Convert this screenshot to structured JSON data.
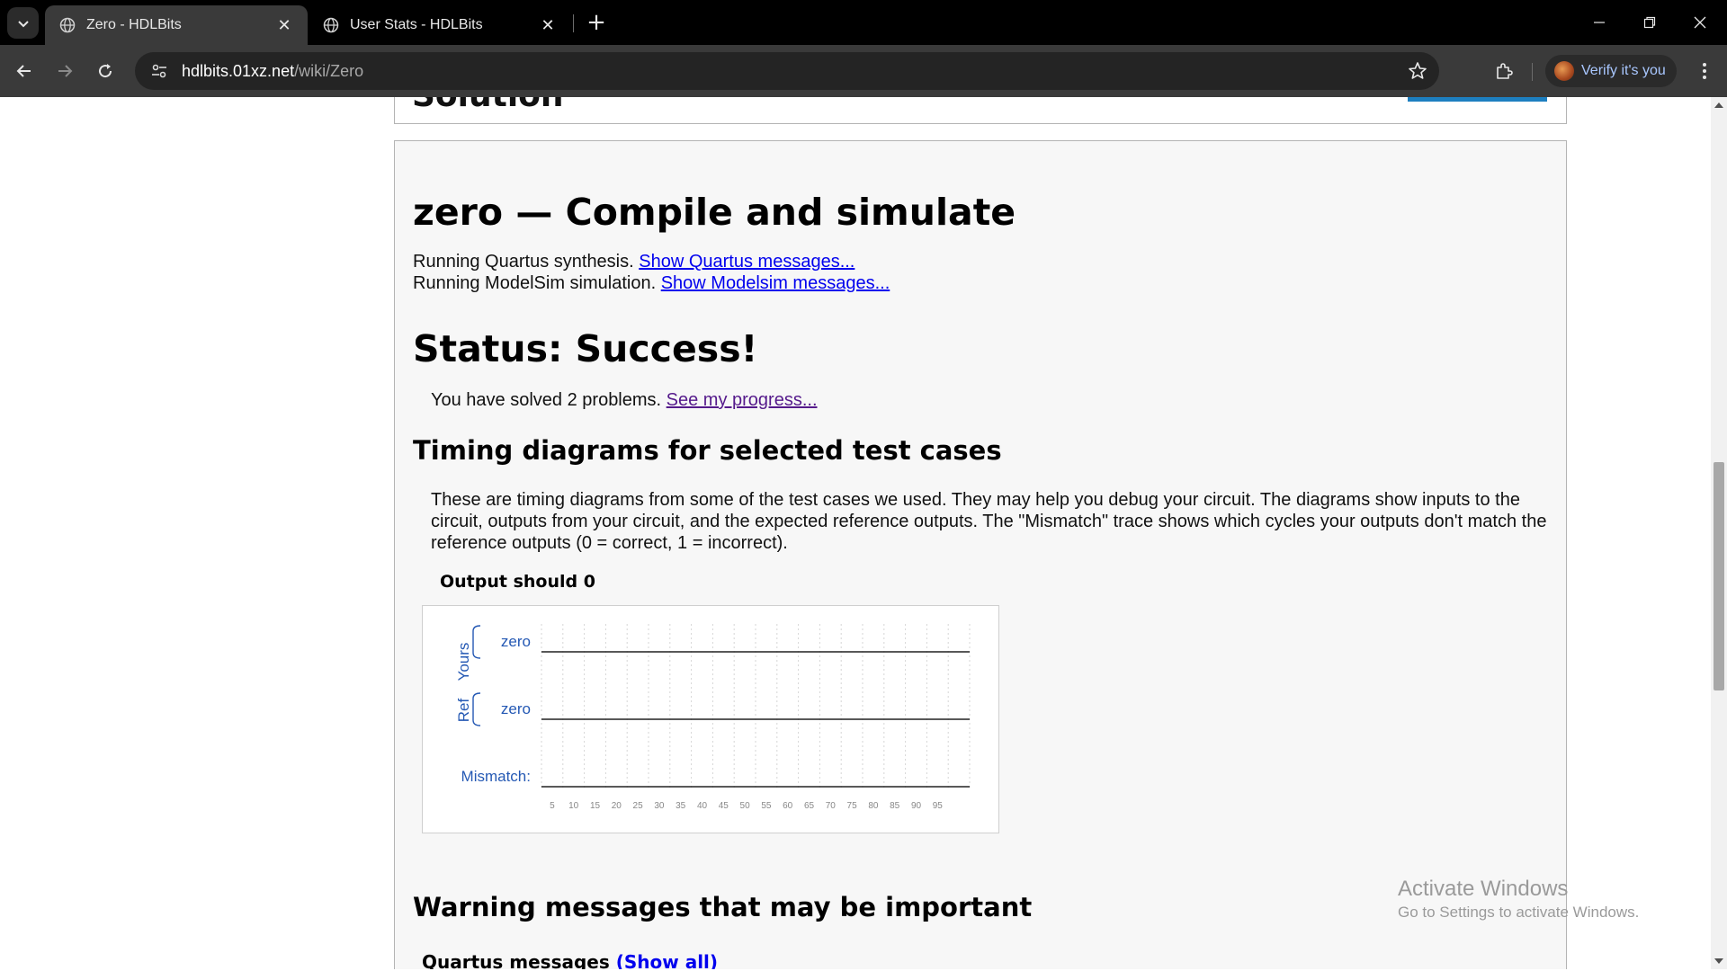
{
  "browser": {
    "tabs": [
      {
        "title": "Zero - HDLBits",
        "active": true
      },
      {
        "title": "User Stats - HDLBits",
        "active": false
      }
    ],
    "url_host": "hdlbits.01xz.net",
    "url_path": "/wiki/Zero",
    "verify_label": "Verify it's you"
  },
  "page": {
    "previous_heading": "Solution",
    "title": "zero — Compile and simulate",
    "quartus_line": "Running Quartus synthesis.",
    "quartus_link": "Show Quartus messages...",
    "modelsim_line": "Running ModelSim simulation.",
    "modelsim_link": "Show Modelsim messages...",
    "status": "Status: Success!",
    "solved_text": "You have solved 2 problems.",
    "progress_link": "See my progress...",
    "timing_heading": "Timing diagrams for selected test cases",
    "timing_paragraph": "These are timing diagrams from some of the test cases we used. They may help you debug your circuit. The diagrams show inputs to the circuit, outputs from your circuit, and the expected reference outputs. The \"Mismatch\" trace shows which cycles your outputs don't match the reference outputs (0 = correct, 1 = incorrect).",
    "testcase_title": "Output should 0",
    "waveform": {
      "group_yours": "Yours",
      "group_ref": "Ref",
      "signal_yours": "zero",
      "signal_ref": "zero",
      "mismatch_label": "Mismatch:",
      "ticks": [
        "5",
        "10",
        "15",
        "20",
        "25",
        "30",
        "35",
        "40",
        "45",
        "50",
        "55",
        "60",
        "65",
        "70",
        "75",
        "80",
        "85",
        "90",
        "95"
      ],
      "yours_values": [
        0,
        0,
        0,
        0,
        0,
        0,
        0,
        0,
        0,
        0,
        0,
        0,
        0,
        0,
        0,
        0,
        0,
        0,
        0,
        0
      ],
      "ref_values": [
        0,
        0,
        0,
        0,
        0,
        0,
        0,
        0,
        0,
        0,
        0,
        0,
        0,
        0,
        0,
        0,
        0,
        0,
        0,
        0
      ],
      "mismatch_values": [
        0,
        0,
        0,
        0,
        0,
        0,
        0,
        0,
        0,
        0,
        0,
        0,
        0,
        0,
        0,
        0,
        0,
        0,
        0,
        0
      ],
      "label_color": "#2559b4"
    },
    "warnings_heading": "Warning messages that may be important",
    "quartus_messages_label": "Quartus messages",
    "show_all_link": "(Show all)"
  },
  "watermark": {
    "line1": "Activate Windows",
    "line2": "Go to Settings to activate Windows."
  }
}
